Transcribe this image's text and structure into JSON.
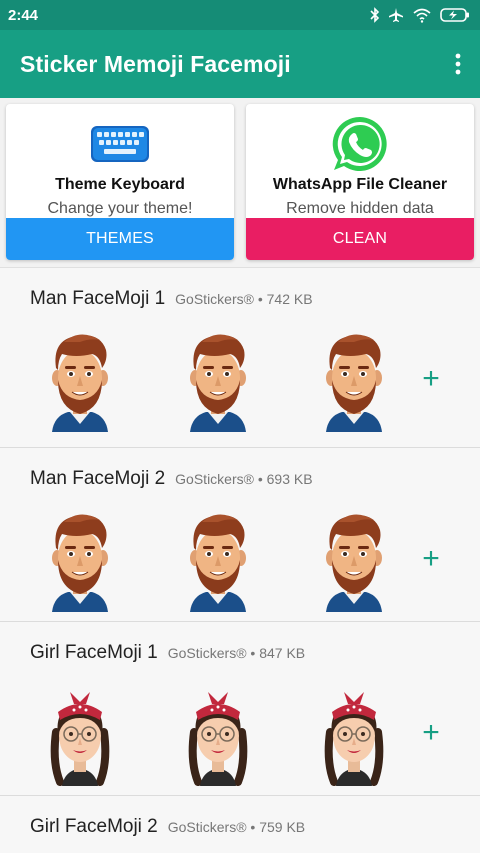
{
  "status_bar": {
    "time": "2:44",
    "icons": [
      "bluetooth-icon",
      "airplane-icon",
      "wifi-icon",
      "battery-charging-icon"
    ],
    "background": "#158c76"
  },
  "app_bar": {
    "title": "Sticker Memoji Facemoji",
    "menu_icon": "more-vert-icon",
    "background": "#179f84"
  },
  "promos": [
    {
      "icon": "keyboard-icon",
      "title": "Theme Keyboard",
      "subtitle": "Change your theme!",
      "button_label": "THEMES",
      "button_color": "#2196f3"
    },
    {
      "icon": "whatsapp-icon",
      "title": "WhatsApp File Cleaner",
      "subtitle": "Remove hidden data",
      "button_label": "CLEAN",
      "button_color": "#e91e63"
    }
  ],
  "packs": [
    {
      "name": "Man FaceMoji 1",
      "publisher": "GoStickers®",
      "size": "742 KB",
      "separator": "•",
      "sticker_kind": "man",
      "stickers": [
        "man-smile-sticker",
        "man-laugh-sticker",
        "man-surprised-sticker"
      ]
    },
    {
      "name": "Man FaceMoji 2",
      "publisher": "GoStickers®",
      "size": "693 KB",
      "separator": "•",
      "sticker_kind": "man",
      "stickers": [
        "man-shocked-sticker",
        "man-wink-sticker",
        "man-heart-eyes-sticker"
      ]
    },
    {
      "name": "Girl FaceMoji 1",
      "publisher": "GoStickers®",
      "size": "847 KB",
      "separator": "•",
      "sticker_kind": "girl",
      "stickers": [
        "girl-smile-sticker",
        "girl-grin-sticker",
        "girl-surprised-sticker"
      ]
    },
    {
      "name": "Girl FaceMoji 2",
      "publisher": "GoStickers®",
      "size": "759 KB",
      "separator": "•",
      "sticker_kind": "girl",
      "stickers": []
    }
  ],
  "add_icon": "add-icon",
  "colors": {
    "accent": "#179f84"
  }
}
